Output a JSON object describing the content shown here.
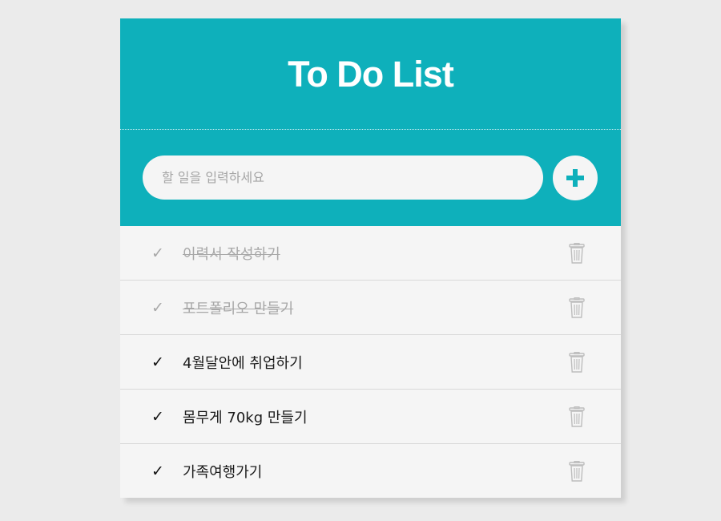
{
  "header": {
    "title": "To Do List"
  },
  "input": {
    "placeholder": "할 일을 입력하세요",
    "value": ""
  },
  "todos": [
    {
      "text": "이력서 작성하기",
      "done": true
    },
    {
      "text": "포트폴리오 만들기",
      "done": true
    },
    {
      "text": "4월달안에 취업하기",
      "done": false
    },
    {
      "text": "몸무게 70kg 만들기",
      "done": false
    },
    {
      "text": "가족여행가기",
      "done": false
    }
  ],
  "icons": {
    "check": "✓",
    "add": "plus-icon",
    "delete": "trash-icon"
  },
  "colors": {
    "accent": "#0eb0bb",
    "background": "#ebebeb",
    "panel": "#f5f5f5",
    "done_text": "#a8a8a8"
  }
}
